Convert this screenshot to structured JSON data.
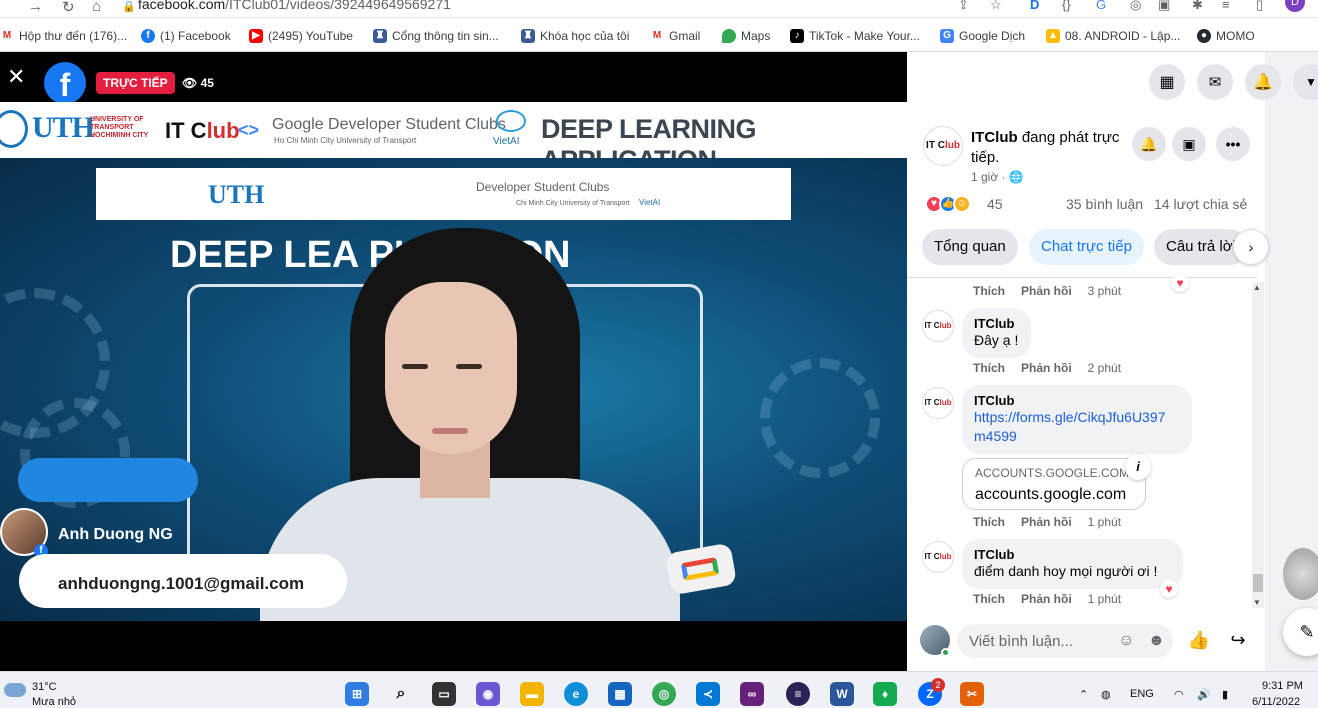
{
  "browser": {
    "url_host": "facebook.com",
    "url_path": "/ITClub01/videos/392449649569271",
    "profile_initial": "D"
  },
  "bookmarks": [
    {
      "label": "Hộp thư đến (176)...",
      "icon": "gmail-icon",
      "color": "#d93025"
    },
    {
      "label": "(1) Facebook",
      "icon": "facebook-icon",
      "color": "#1877f2"
    },
    {
      "label": "(2495) YouTube",
      "icon": "youtube-icon",
      "color": "#ff0000"
    },
    {
      "label": "Cổng thông tin sin...",
      "icon": "school-icon",
      "color": "#3b5998"
    },
    {
      "label": "Khóa học của tôi",
      "icon": "school-icon",
      "color": "#3b5998"
    },
    {
      "label": "Gmail",
      "icon": "gmail-icon",
      "color": "#d93025"
    },
    {
      "label": "Maps",
      "icon": "maps-icon",
      "color": "#34a853"
    },
    {
      "label": "TikTok - Make Your...",
      "icon": "tiktok-icon",
      "color": "#000000"
    },
    {
      "label": "Google Dịch",
      "icon": "translate-icon",
      "color": "#4285f4"
    },
    {
      "label": "08. ANDROID - Lập...",
      "icon": "drive-icon",
      "color": "#fbbc04"
    },
    {
      "label": "MOMO",
      "icon": "github-icon",
      "color": "#24292e"
    }
  ],
  "video": {
    "live_label": "TRỰC TIẾP",
    "viewer_count": "45",
    "banner": {
      "uth": "UTH",
      "uth_sub": "UNIVERSITY OF TRANSPORT HOCHIMINH CITY",
      "itclub_prefix": "IT C",
      "itclub_suffix": "lub",
      "gdsc_title": "Google Developer Student Clubs",
      "gdsc_sub": "Ho Chi Minh City University of Transport",
      "vietai": "VietAI",
      "title": "DEEP LEARNING APPLICATION"
    },
    "inner_banner": {
      "uth": "UTH",
      "dsc": "Developer Student Clubs",
      "sub": "Chi Minh City University of Transport",
      "vietai": "VietAI"
    },
    "slide_title": "DEEP LEA          PLICATION",
    "presenter_name": "Anh Duong NG",
    "presenter_email": "anhduongng.1001@gmail.com"
  },
  "post": {
    "page_name": "ITClub",
    "status_text": " đang phát trực tiếp.",
    "time": "1 giờ · ",
    "avatar_prefix": "IT C",
    "avatar_suffix": "lub",
    "reaction_count": "45",
    "comments_count": "35 bình luận",
    "shares_count": "14 lượt chia sẻ"
  },
  "tabs": [
    {
      "label": "Tổng quan",
      "active": false
    },
    {
      "label": "Chat trực tiếp",
      "active": true
    },
    {
      "label": "Câu trả lời",
      "active": false
    }
  ],
  "comment_actions": {
    "like": "Thích",
    "reply": "Phản hồi"
  },
  "comments": [
    {
      "author": "",
      "text": "",
      "time": "3 phút"
    },
    {
      "author": "ITClub",
      "text": "Đây ạ !",
      "time": "2 phút"
    },
    {
      "author": "ITClub",
      "link": "https://forms.gle/CikqJfu6U397m4599",
      "link_line1": "https://forms.gle/CikqJfu6U397",
      "link_line2": "m4599",
      "card_domain": "ACCOUNTS.GOOGLE.COM",
      "card_title": "accounts.google.com",
      "time": "1 phút"
    },
    {
      "author": "ITClub",
      "text": "điểm danh hoy mọi người ơi !",
      "time": "1 phút"
    }
  ],
  "composer": {
    "placeholder": "Viết bình luận..."
  },
  "taskbar": {
    "temperature": "31°C",
    "weather": "Mưa nhỏ",
    "language": "ENG",
    "time": "9:31 PM",
    "date": "6/11/2022",
    "zalo_badge": "2"
  }
}
